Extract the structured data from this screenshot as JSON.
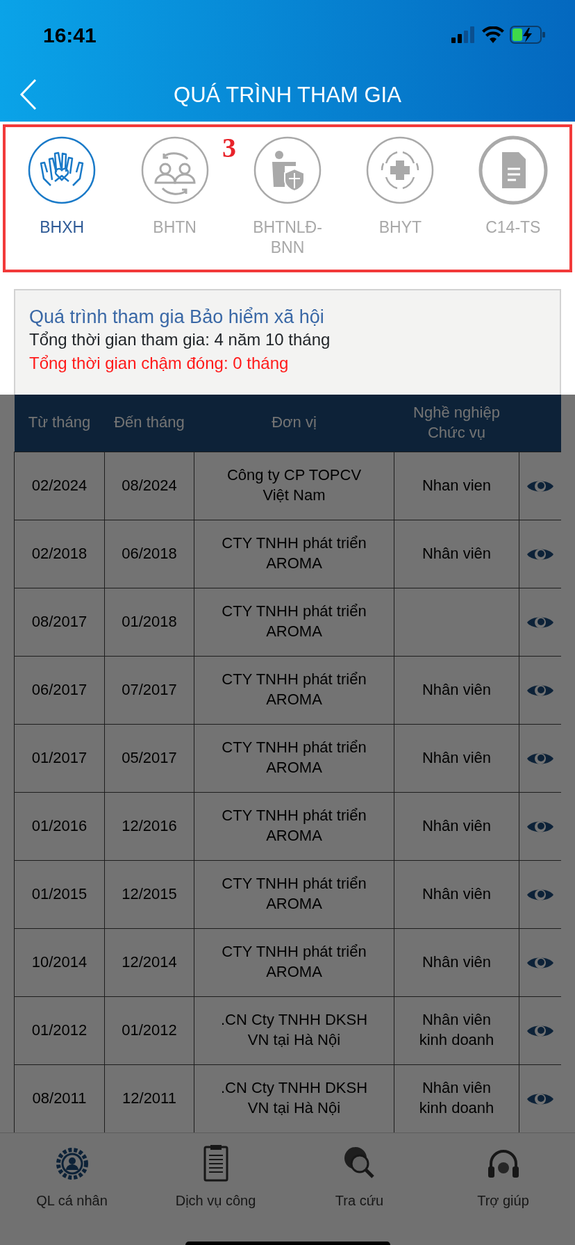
{
  "status_bar": {
    "time": "16:41"
  },
  "header": {
    "title": "QUÁ TRÌNH THAM GIA"
  },
  "annotation": {
    "label": "3"
  },
  "tabs": [
    {
      "label": "BHXH",
      "kind": "hands",
      "selected": true
    },
    {
      "label": "BHTN",
      "kind": "exchange",
      "selected": false
    },
    {
      "label": "BHTNLĐ-BNN",
      "kind": "shield",
      "selected": false
    },
    {
      "label": "BHYT",
      "kind": "medical",
      "selected": false
    },
    {
      "label": "C14-TS",
      "kind": "document",
      "selected": false
    }
  ],
  "summary": {
    "title": "Quá trình tham gia Bảo hiểm xã hội",
    "total": "Tổng thời gian tham gia: 4 năm 10 tháng",
    "late": "Tổng thời gian chậm đóng: 0 tháng"
  },
  "dimmed": true,
  "table": {
    "columns": [
      "Từ tháng",
      "Đến tháng",
      "Đơn vị",
      "Nghề nghiệp Chức vụ"
    ],
    "rows": [
      {
        "from": "02/2024",
        "to": "08/2024",
        "unit": "Công ty CP TOPCV Việt Nam",
        "job": "Nhan vien"
      },
      {
        "from": "02/2018",
        "to": "06/2018",
        "unit": "CTY TNHH phát triển AROMA",
        "job": "Nhân viên"
      },
      {
        "from": "08/2017",
        "to": "01/2018",
        "unit": "CTY TNHH phát triển AROMA"
      },
      {
        "from": "06/2017",
        "to": "07/2017",
        "unit": "CTY TNHH phát triển AROMA",
        "job": "Nhân viên"
      },
      {
        "from": "01/2017",
        "to": "05/2017",
        "unit": "CTY TNHH phát triển AROMA",
        "job": "Nhân viên"
      },
      {
        "from": "01/2016",
        "to": "12/2016",
        "unit": "CTY TNHH phát triển AROMA",
        "job": "Nhân viên"
      },
      {
        "from": "01/2015",
        "to": "12/2015",
        "unit": "CTY TNHH phát triển AROMA",
        "job": "Nhân viên"
      },
      {
        "from": "10/2014",
        "to": "12/2014",
        "unit": "CTY TNHH phát triển AROMA",
        "job": "Nhân viên"
      },
      {
        "from": "01/2012",
        "to": "01/2012",
        "unit": ".CN Cty TNHH DKSH VN tại Hà Nội",
        "job": "Nhân viên kinh doanh"
      },
      {
        "from": "08/2011",
        "to": "12/2011",
        "unit": ".CN Cty TNHH DKSH VN tại Hà Nội",
        "job": "Nhân viên kinh doanh"
      }
    ]
  },
  "bottom_nav": [
    {
      "label": "QL cá nhân",
      "kind": "profile"
    },
    {
      "label": "Dịch vụ công",
      "kind": "services"
    },
    {
      "label": "Tra cứu",
      "kind": "lookup"
    },
    {
      "label": "Trợ giúp",
      "kind": "help"
    }
  ]
}
